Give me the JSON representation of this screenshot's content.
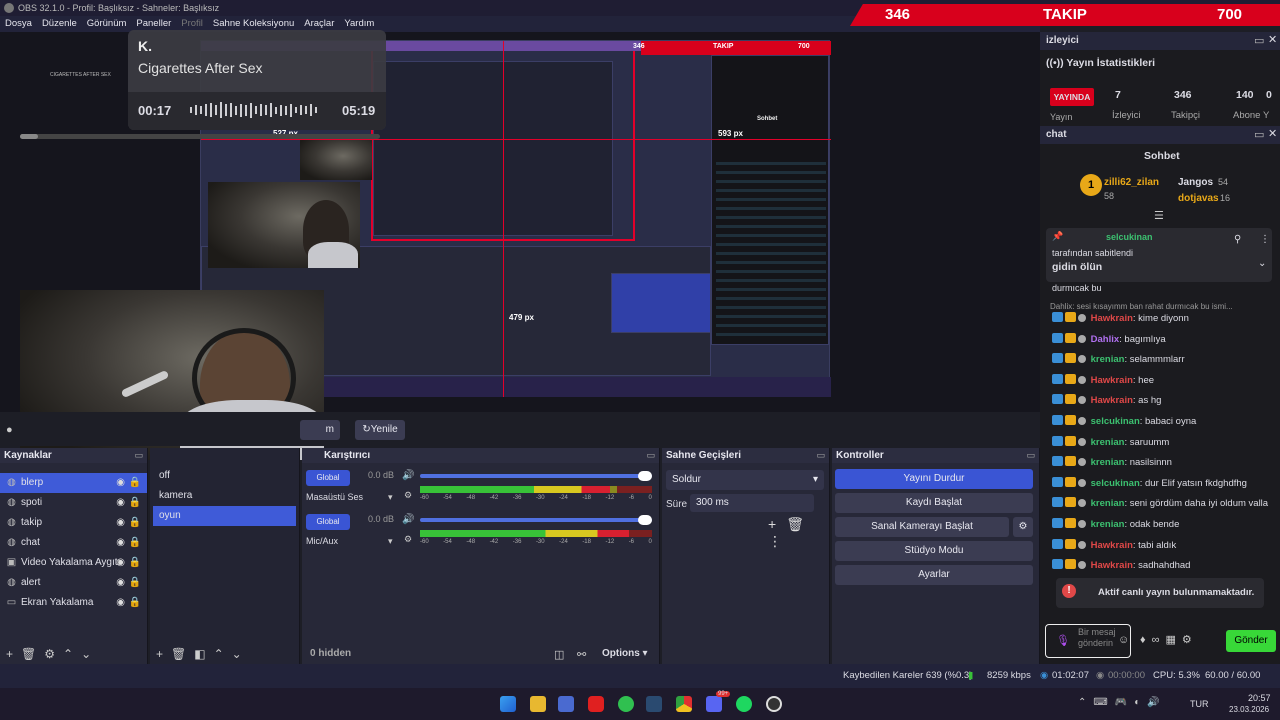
{
  "window": {
    "title": "OBS 32.1.0 - Profil: Başlıksız - Sahneler: Başlıksız"
  },
  "menu": [
    "Dosya",
    "Düzenle",
    "Görünüm",
    "Paneller",
    "Profil",
    "Sahne Koleksiyonu",
    "Araçlar",
    "Yardım"
  ],
  "overlay": {
    "count1": "346",
    "label": "TAKIP",
    "count2": "700"
  },
  "preview": {
    "inner_tag": "CIGARETTES AFTER SEX",
    "px_right": "593 px",
    "px_bottom": "479 px",
    "px_left": "527 px",
    "inner_title": "Sohbet",
    "inner_follow": "TAKIP",
    "inner_n1": "346",
    "inner_n2": "700"
  },
  "music": {
    "artist": "K.",
    "song": "Cigarettes After Sex",
    "elapsed": "00:17",
    "total": "05:19",
    "progress": 0.05
  },
  "toolbar": {
    "refresh": "Yenile",
    "partial": "m"
  },
  "sources": {
    "title": "Kaynaklar",
    "items": [
      {
        "label": "blerp",
        "icon": "browser-icon"
      },
      {
        "label": "spoti",
        "icon": "browser-icon"
      },
      {
        "label": "takip",
        "icon": "browser-icon"
      },
      {
        "label": "chat",
        "icon": "browser-icon"
      },
      {
        "label": "Video Yakalama Aygıtı",
        "icon": "camera-icon"
      },
      {
        "label": "alert",
        "icon": "browser-icon"
      },
      {
        "label": "Ekran Yakalama",
        "icon": "monitor-icon"
      }
    ]
  },
  "scenes": {
    "items": [
      "off",
      "kamera",
      "oyun"
    ]
  },
  "mixer": {
    "title": "Karıştırıcı",
    "tracks": [
      {
        "tag": "Global",
        "db": "0.0 dB",
        "name": "Masaüstü Ses",
        "level": 0.82
      },
      {
        "tag": "Global",
        "db": "0.0 dB",
        "name": "Mic/Aux",
        "level": 0.9
      }
    ],
    "scale": [
      "-60",
      "-54",
      "-48",
      "-42",
      "-36",
      "-30",
      "-24",
      "-18",
      "-12",
      "-6",
      "0"
    ],
    "hidden": "0 hidden",
    "options": "Options"
  },
  "transitions": {
    "title": "Sahne Geçişleri",
    "selected": "Soldur",
    "duration_label": "Süre",
    "duration": "300 ms"
  },
  "controls": {
    "title": "Kontroller",
    "buttons": [
      "Yayını Durdur",
      "Kaydı Başlat",
      "Sanal Kamerayı Başlat",
      "Stüdyo Modu",
      "Ayarlar"
    ]
  },
  "viewers": {
    "title": "izleyici",
    "stats_title": "Yayın İstatistikleri",
    "live": "YAYINDA",
    "live_sub": "Yayın",
    "values": [
      "7",
      "346",
      "140",
      "0"
    ],
    "labels": [
      "İzleyici",
      "Takipçi",
      "Abone",
      "Y"
    ]
  },
  "chat": {
    "panel": "chat",
    "header": "Sohbet",
    "top": [
      {
        "name": "zilli62_zilan",
        "n": "58",
        "rank": "1"
      },
      {
        "name": "Jangos",
        "n": "54"
      },
      {
        "name": "dotjavas",
        "n": "16"
      }
    ],
    "pinned": {
      "user": "selcukinan",
      "text": "tarafından sabitlendi",
      "msg": "gidin ölün"
    },
    "reply_tail": "durmıcak bu",
    "reply": "Dahlix: sesi kısayımm ban rahat durmıcak bu ismi...",
    "messages": [
      {
        "name": "Hawkrain",
        "color": "#e04848",
        "text": ": kime diyonn"
      },
      {
        "name": "Dahlix",
        "color": "#b070f0",
        "text": ": bagımlıya"
      },
      {
        "name": "krenian",
        "color": "#3cc070",
        "text": ": selammmlarr"
      },
      {
        "name": "Hawkrain",
        "color": "#e04848",
        "text": ": hee"
      },
      {
        "name": "Hawkrain",
        "color": "#e04848",
        "text": ": as hg"
      },
      {
        "name": "selcukinan",
        "color": "#3cc070",
        "text": ": babaci oyna"
      },
      {
        "name": "krenian",
        "color": "#3cc070",
        "text": ": saruumm"
      },
      {
        "name": "krenian",
        "color": "#3cc070",
        "text": ": nasilsinnn"
      },
      {
        "name": "selcukinan",
        "color": "#3cc070",
        "text": ": dur Elif yatsın fkdghdfhg"
      },
      {
        "name": "krenian",
        "color": "#3cc070",
        "text": ": seni gördüm daha iyi oldum valla"
      },
      {
        "name": "krenian",
        "color": "#3cc070",
        "text": ": odak bende"
      },
      {
        "name": "Hawkrain",
        "color": "#e04848",
        "text": ": tabi aldık"
      },
      {
        "name": "Hawkrain",
        "color": "#e04848",
        "text": ": sadhahdhad"
      }
    ],
    "alert": "Aktif canlı yayın bulunmamaktadır.",
    "placeholder": "Bir mesaj gönderin",
    "send": "Gönder"
  },
  "status": {
    "dropped": "Kaybedilen Kareler 639 (%0.3)",
    "bitrate": "8259 kbps",
    "rec_time": "01:02:07",
    "stream_time": "00:00:00",
    "cpu": "CPU: 5.3%",
    "fps": "60.00 / 60.00 FPS"
  },
  "taskbar": {
    "lang": "TUR",
    "time": "20:57",
    "date": "23.03.2026",
    "badge": "99+"
  }
}
